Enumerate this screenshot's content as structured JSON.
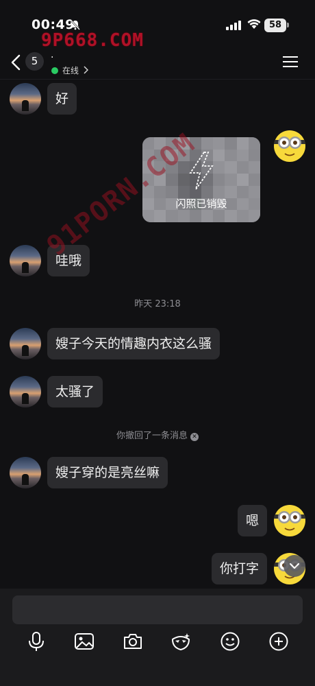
{
  "status_bar": {
    "time": "00:49",
    "battery": "58",
    "watermark": "9P668.COM"
  },
  "header": {
    "unread_count": "5",
    "title": "·",
    "online_status": "在线"
  },
  "watermark_diagonal": "91PORN.COM",
  "messages": {
    "m1": "好",
    "flash_photo": "闪照已销毁",
    "m2": "哇哦",
    "timestamp": "昨天 23:18",
    "m3": "嫂子今天的情趣内衣这么骚",
    "m4": "太骚了",
    "recall_notice": "你撤回了一条消息",
    "m5": "嫂子穿的是亮丝嘛",
    "m6": "嗯",
    "m7": "你打字"
  },
  "toolbar": {
    "icons": [
      "microphone-icon",
      "image-icon",
      "camera-icon",
      "face-mask-icon",
      "emoji-icon",
      "plus-icon"
    ]
  },
  "colors": {
    "background": "#111113",
    "bubble": "#2B2B2E",
    "online": "#2ACB63",
    "avatar_right": "#F7D93B"
  }
}
